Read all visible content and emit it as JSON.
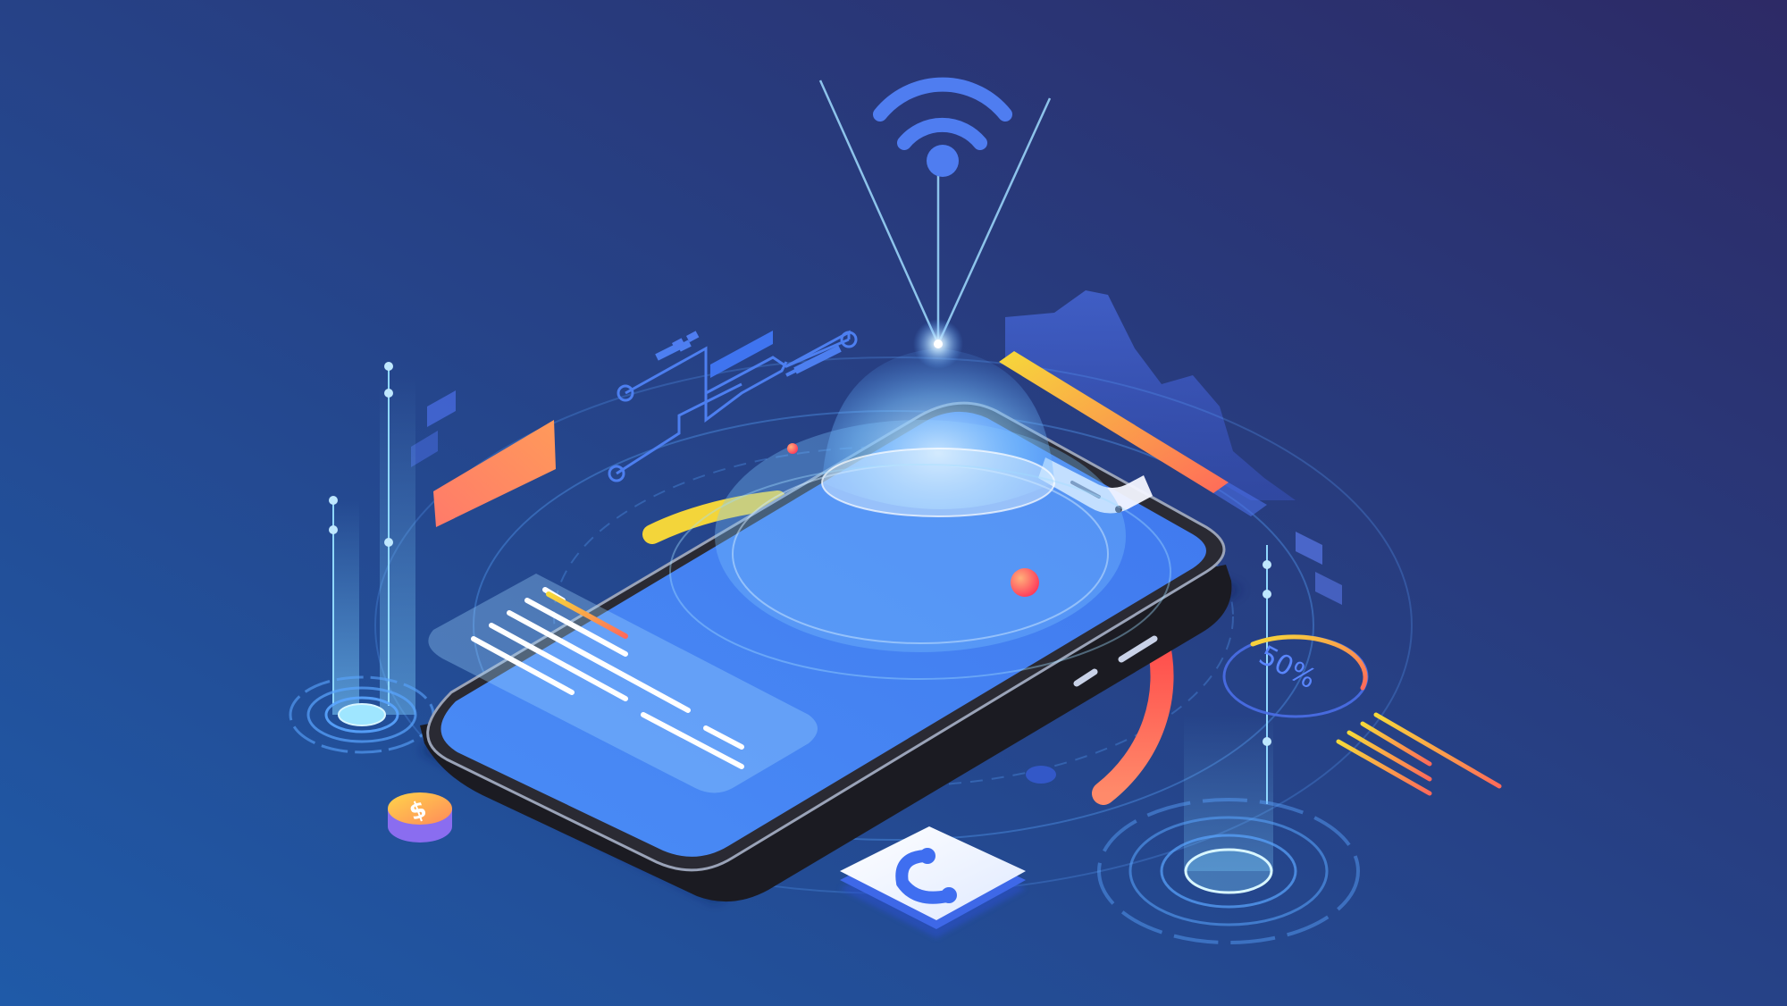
{
  "illustration": {
    "gauge": {
      "label": "50%",
      "level_fraction": 0.5
    },
    "icons": {
      "wifi": "wifi-icon",
      "phone_call": "phone-call-icon",
      "coin": "dollar-coin-icon",
      "smartphone": "smartphone-icon"
    }
  },
  "colors": {
    "background_start": "#1f5aa8",
    "background_end": "#2d2a66",
    "screen_blue": "#3f7ff2",
    "glow_blue": "#6fb6ff",
    "accent_yellow": "#f3d53a",
    "accent_orange": "#ff8a5a",
    "accent_red": "#ff5a5a",
    "accent_purple": "#6c7cff"
  }
}
